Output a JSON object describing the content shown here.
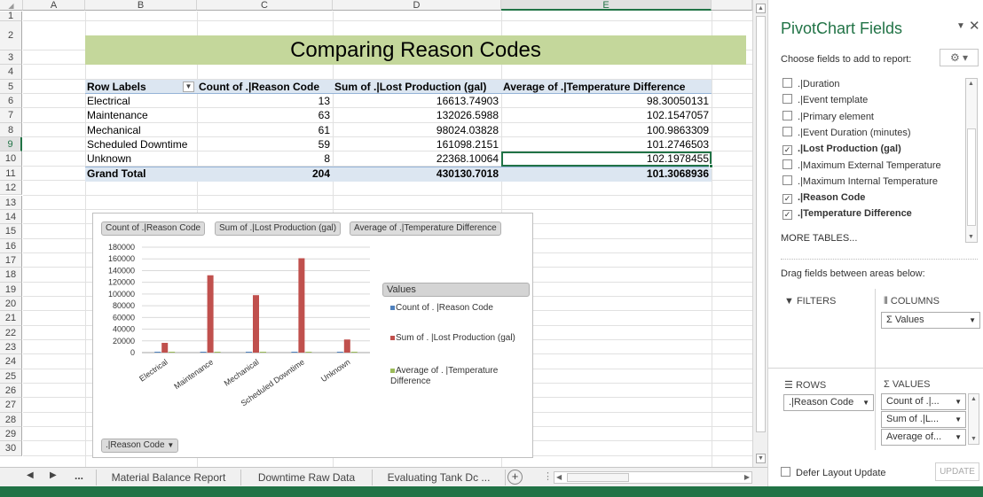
{
  "sheet": {
    "columns": [
      "A",
      "B",
      "C",
      "D",
      "E"
    ],
    "rows": [
      "1",
      "2",
      "3",
      "4",
      "5",
      "6",
      "7",
      "8",
      "9",
      "10",
      "11",
      "12",
      "13",
      "14",
      "15",
      "16",
      "17",
      "18",
      "19",
      "20",
      "21",
      "22",
      "23",
      "24",
      "25",
      "26",
      "27",
      "28",
      "29",
      "30"
    ],
    "title": "Comparing Reason Codes",
    "pivot": {
      "headers": [
        "Row Labels",
        "Count of .|Reason Code",
        "Sum of .|Lost Production (gal)",
        "Average of .|Temperature Difference"
      ],
      "rows": [
        [
          "Electrical",
          "13",
          "16613.74903",
          "98.30050131"
        ],
        [
          "Maintenance",
          "63",
          "132026.5988",
          "102.1547057"
        ],
        [
          "Mechanical",
          "61",
          "98024.03828",
          "100.9863309"
        ],
        [
          "Scheduled Downtime",
          "59",
          "161098.2151",
          "101.2746503"
        ],
        [
          "Unknown",
          "8",
          "22368.10064",
          "102.1978455"
        ]
      ],
      "total": [
        "Grand Total",
        "204",
        "430130.7018",
        "101.3068936"
      ]
    }
  },
  "chart": {
    "field_buttons": [
      "Count of .|Reason Code",
      "Sum of .|Lost Production (gal)",
      "Average of .|Temperature Difference"
    ],
    "axis_field_button": ".|Reason Code",
    "legend_title": "Values",
    "legend": [
      "Count of . |Reason Code",
      "Sum of . |Lost Production (gal)",
      "Average of . |Temperature Difference"
    ]
  },
  "chart_data": {
    "type": "bar",
    "categories": [
      "Electrical",
      "Maintenance",
      "Mechanical",
      "Scheduled Downtime",
      "Unknown"
    ],
    "series": [
      {
        "name": "Count of . |Reason Code",
        "values": [
          13,
          63,
          61,
          59,
          8
        ],
        "color": "#4f81bd"
      },
      {
        "name": "Sum of . |Lost Production (gal)",
        "values": [
          16613.74903,
          132026.5988,
          98024.03828,
          161098.2151,
          22368.10064
        ],
        "color": "#c0504d"
      },
      {
        "name": "Average of . |Temperature Difference",
        "values": [
          98.30050131,
          102.1547057,
          100.9863309,
          101.2746503,
          102.1978455
        ],
        "color": "#9bbb59"
      }
    ],
    "yticks": [
      "180000",
      "160000",
      "140000",
      "120000",
      "100000",
      "80000",
      "60000",
      "40000",
      "20000",
      "0"
    ],
    "ylim": [
      0,
      180000
    ],
    "legend_position": "right",
    "grid": true
  },
  "tabs": {
    "nav_more": "...",
    "items": [
      "Material Balance Report",
      "Downtime Raw Data",
      "Evaluating Tank Dc ..."
    ],
    "add": "+"
  },
  "panel": {
    "title": "PivotChart Fields",
    "subtitle": "Choose fields to add to report:",
    "fields": [
      {
        "label": ".|Duration",
        "checked": false,
        "bold": false
      },
      {
        "label": ".|Event template",
        "checked": false,
        "bold": false
      },
      {
        "label": ".|Primary element",
        "checked": false,
        "bold": false
      },
      {
        "label": ".|Event Duration (minutes)",
        "checked": false,
        "bold": false
      },
      {
        "label": ".|Lost Production (gal)",
        "checked": true,
        "bold": true
      },
      {
        "label": ".|Maximum External Temperature",
        "checked": false,
        "bold": false
      },
      {
        "label": ".|Maximum Internal Temperature",
        "checked": false,
        "bold": false
      },
      {
        "label": ".|Reason Code",
        "checked": true,
        "bold": true
      },
      {
        "label": ".|Temperature Difference",
        "checked": true,
        "bold": true
      }
    ],
    "more_tables": "MORE TABLES...",
    "drag_text": "Drag fields between areas below:",
    "filters_label": "FILTERS",
    "columns_label": "COLUMNS",
    "rows_label": "ROWS",
    "values_label": "VALUES",
    "columns_item": "Σ Values",
    "rows_item": ".|Reason Code",
    "values_items": [
      "Count of .|...",
      "Sum of .|L...",
      "Average of..."
    ],
    "defer_label": "Defer Layout Update",
    "update_label": "UPDATE"
  }
}
